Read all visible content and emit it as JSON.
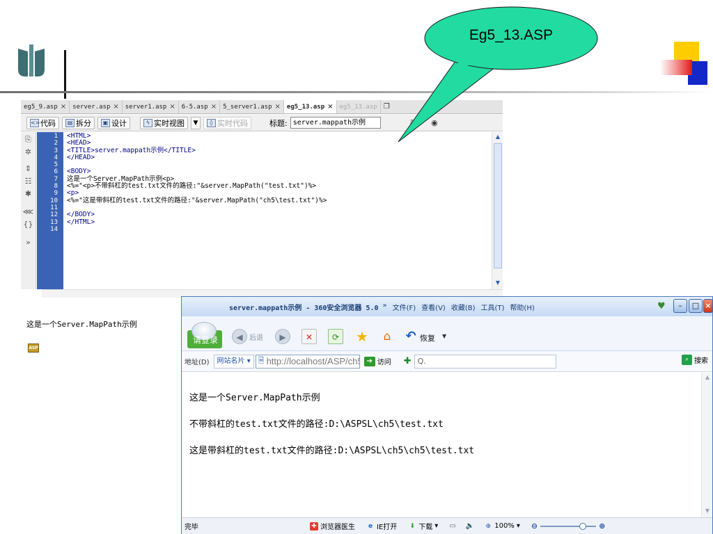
{
  "callout": {
    "text": "Eg5_13.ASP"
  },
  "editor": {
    "tabs": [
      {
        "label": "eg5_9.asp",
        "active": false
      },
      {
        "label": "server.asp",
        "active": false
      },
      {
        "label": "server1.asp",
        "active": false
      },
      {
        "label": "6-5.asp",
        "active": false
      },
      {
        "label": "5_server1.asp",
        "active": false
      },
      {
        "label": "eg5_13.asp",
        "active": true
      }
    ],
    "overflow_tab": "eg5_13.asp",
    "toolbar": {
      "code_label": "代码",
      "split_label": "拆分",
      "design_label": "设计",
      "live_view_label": "实时视图",
      "live_code_label": "实时代码",
      "title_label": "标题:",
      "title_value": "server.mappath示例"
    },
    "line_numbers": [
      "1",
      "2",
      "3",
      "4",
      "5",
      "6",
      "7",
      "8",
      "9",
      "10",
      "11",
      "12",
      "13",
      "14"
    ],
    "code_lines": [
      "<HTML>",
      "<HEAD>",
      "<TITLE>server.mappath示例</TITLE>",
      "</HEAD>",
      "",
      "<BODY>",
      "这是一个Server.MapPath示例<p>",
      "<%=\"<p>不带斜杠的test.txt文件的路径:\"&server.MapPath(\"test.txt\")%>",
      "<p>",
      "<%=\"这是带斜杠的test.txt文件的路径:\"&server.MapPath(\"ch5\\test.txt\")%>",
      "",
      "</BODY>",
      "</HTML>",
      ""
    ],
    "design_view_text": "这是一个Server.MapPath示例",
    "asp_badge": "ASP"
  },
  "browser": {
    "title": "server.mappath示例 - 360安全浏览器 5.0",
    "menu_chevron": "»",
    "menu": [
      "文件(F)",
      "查看(V)",
      "收藏(B)",
      "工具(T)",
      "帮助(H)"
    ],
    "login_label": "请登录",
    "back_label": "后退",
    "restore_label": "恢复",
    "address_label": "地址(D)",
    "site_label": "网站名片",
    "url": "http://localhost/ASP/ch5/eg5",
    "go_label": "访问",
    "search_placeholder": "Q.",
    "search_button": "搜索",
    "content_lines": [
      "这是一个Server.MapPath示例",
      "不带斜杠的test.txt文件的路径:D:\\ASPSL\\ch5\\test.txt",
      "这是带斜杠的test.txt文件的路径:D:\\ASPSL\\ch5\\ch5\\test.txt"
    ],
    "status": {
      "done": "完毕",
      "doctor": "浏览器医生",
      "ie_open": "IE打开",
      "download": "下载",
      "zoom": "100%",
      "zoom_level": 0.8
    }
  }
}
